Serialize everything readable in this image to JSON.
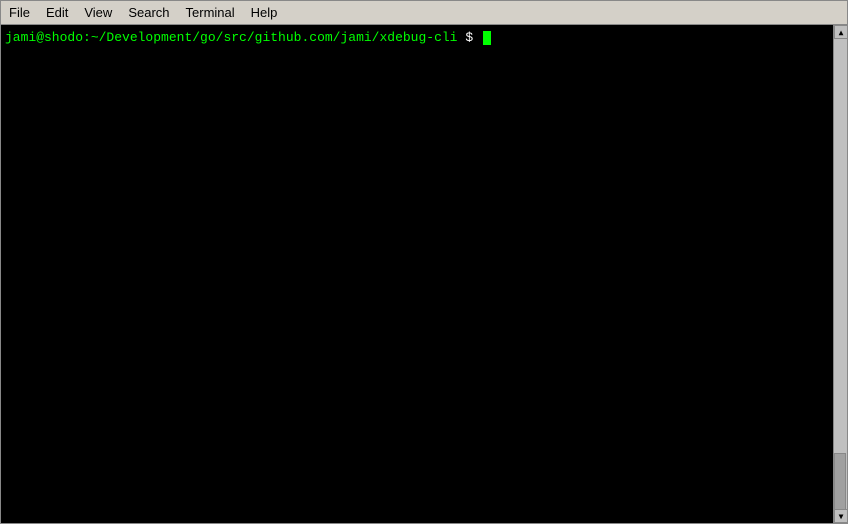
{
  "menubar": {
    "items": [
      {
        "id": "file",
        "label": "File"
      },
      {
        "id": "edit",
        "label": "Edit"
      },
      {
        "id": "view",
        "label": "View"
      },
      {
        "id": "search",
        "label": "Search"
      },
      {
        "id": "terminal",
        "label": "Terminal"
      },
      {
        "id": "help",
        "label": "Help"
      }
    ]
  },
  "terminal": {
    "prompt_user": "jami@shodo",
    "prompt_separator": ":",
    "prompt_path": "~/Development/go/src/github.com/jami/xdebug-cli",
    "prompt_dollar": "$"
  }
}
